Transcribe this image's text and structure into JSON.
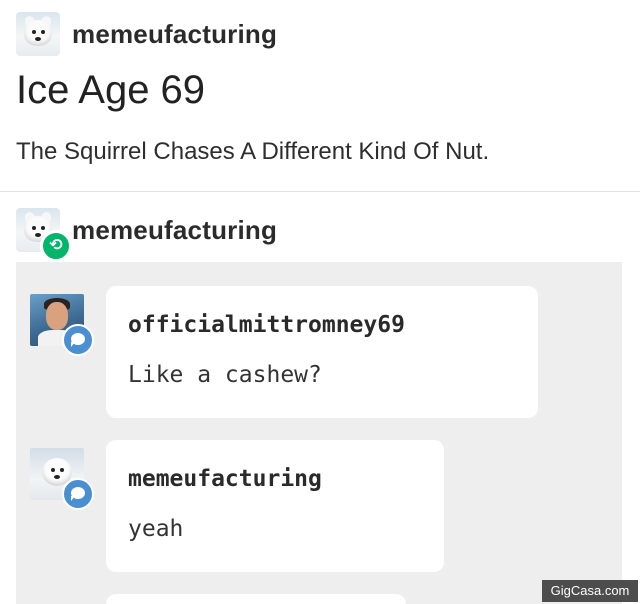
{
  "post": {
    "username": "memeufacturing",
    "title": "Ice Age 69",
    "body": "The Squirrel Chases A Different Kind Of Nut."
  },
  "reblog": {
    "username": "memeufacturing",
    "badge_icon": "reblog-icon",
    "badge_color": "#00b66b"
  },
  "chat": {
    "messages": [
      {
        "name": "officialmittromney69",
        "text": "Like a cashew?",
        "avatar": "man-photo"
      },
      {
        "name": "memeufacturing",
        "text": "yeah",
        "avatar": "dog-photo"
      }
    ],
    "icon": "chat-bubble-icon",
    "icon_color": "#4a8fd1"
  },
  "watermark": "GigCasa.com"
}
